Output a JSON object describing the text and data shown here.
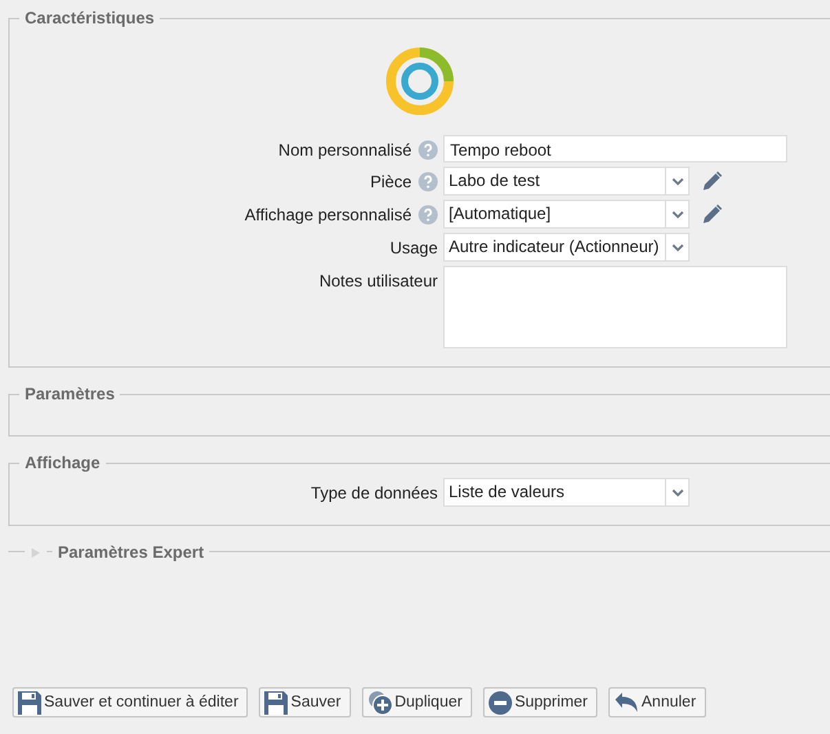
{
  "sections": [
    {
      "title": "Caractéristiques",
      "logo": true,
      "fields": [
        {
          "kind": "text",
          "label": "Nom personnalisé",
          "help": true,
          "value": "Tempo reboot",
          "editable": false
        },
        {
          "kind": "select",
          "label": "Pièce",
          "help": true,
          "value": "Labo de test",
          "editable": true
        },
        {
          "kind": "select",
          "label": "Affichage personnalisé",
          "help": true,
          "value": "[Automatique]",
          "editable": true
        },
        {
          "kind": "select",
          "label": "Usage",
          "help": false,
          "value": "Autre indicateur (Actionneur)",
          "editable": false
        },
        {
          "kind": "textarea",
          "label": "Notes utilisateur",
          "help": false,
          "editable": false
        }
      ]
    },
    {
      "title": "Paramètres"
    },
    {
      "title": "Affichage",
      "fields": [
        {
          "kind": "short-select",
          "label": "Type de données",
          "help": false,
          "value": "Liste de valeurs",
          "editable": false
        }
      ]
    }
  ],
  "expert": {
    "title": "Paramètres Expert",
    "expanded": false
  },
  "buttons": [
    {
      "kind": "save",
      "label": "Sauver et continuer à éditer"
    },
    {
      "kind": "save",
      "label": "Sauver"
    },
    {
      "kind": "duplicate",
      "label": "Dupliquer"
    },
    {
      "kind": "delete",
      "label": "Supprimer"
    },
    {
      "kind": "cancel",
      "label": "Annuler"
    }
  ]
}
